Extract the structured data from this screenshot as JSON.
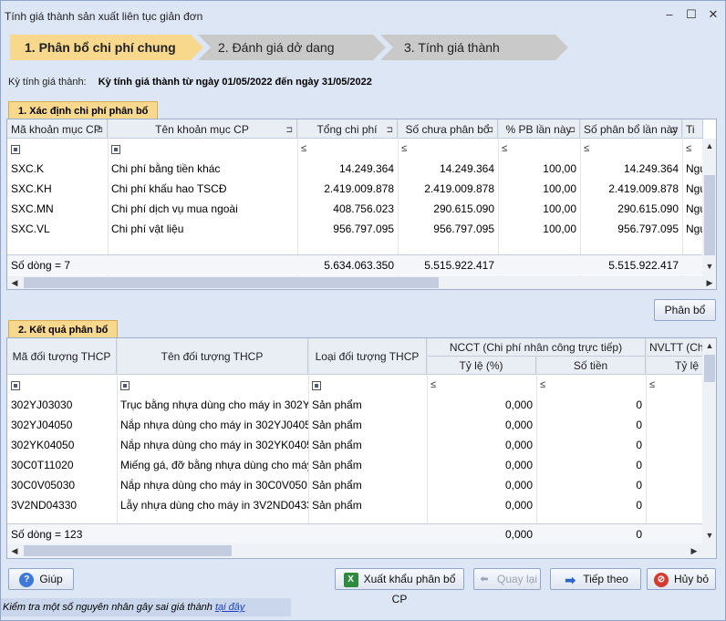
{
  "window": {
    "title": "Tính giá thành sản xuất liên tục giản đơn"
  },
  "steps": [
    "1. Phân bổ chi phí chung",
    "2. Đánh giá dở dang",
    "3. Tính giá thành"
  ],
  "period": {
    "label": "Kỳ tính giá thành:",
    "value": "Kỳ tính giá thành từ ngày 01/05/2022 đến ngày 31/05/2022"
  },
  "section1": {
    "title": "1. Xác định chi phí phân bổ",
    "headers": [
      "Mã khoản mục CP",
      "Tên khoản mục CP",
      "Tổng chi phí",
      "Số chưa phân bổ",
      "% PB lần này",
      "Số phân bổ lần này",
      "Ti"
    ],
    "rows": [
      [
        "SXC.K",
        "Chi phí bằng tiền khác",
        "14.249.364",
        "14.249.364",
        "100,00",
        "14.249.364",
        "Ngu"
      ],
      [
        "SXC.KH",
        "Chi phí khấu hao TSCĐ",
        "2.419.009.878",
        "2.419.009.878",
        "100,00",
        "2.419.009.878",
        "Ngu"
      ],
      [
        "SXC.MN",
        "Chi phí dịch vụ mua ngoài",
        "408.756.023",
        "290.615.090",
        "100,00",
        "290.615.090",
        "Ngu"
      ],
      [
        "SXC.VL",
        "Chi phí vật liệu",
        "956.797.095",
        "956.797.095",
        "100,00",
        "956.797.095",
        "Ngu"
      ]
    ],
    "footer": {
      "count": "Số dòng = 7",
      "total": "5.634.063.350",
      "unallocated": "5.515.922.417",
      "allocated": "5.515.922.417"
    }
  },
  "allocate_button": "Phân bổ",
  "section2": {
    "title": "2. Kết quả phân bổ",
    "headers": {
      "code": "Mã đối tượng THCP",
      "name": "Tên đối tượng THCP",
      "type": "Loại đối tượng THCP",
      "ncct": "NCCT (Chi phí nhân công trực tiếp)",
      "rate": "Tỷ lệ (%)",
      "amount": "Số tiền",
      "nvltt": "NVLTT (Ch",
      "rate2": "Tỷ lệ"
    },
    "rows": [
      [
        "302YJ03030",
        "Trục bằng nhựa dùng cho máy in 302Y...",
        "Sản phẩm",
        "0,000",
        "0"
      ],
      [
        "302YJ04050",
        "Nắp nhựa dùng cho máy in 302YJ04050",
        "Sản phẩm",
        "0,000",
        "0"
      ],
      [
        "302YK04050",
        "Nắp nhựa dùng cho máy in 302YK04050",
        "Sản phẩm",
        "0,000",
        "0"
      ],
      [
        "30C0T11020",
        "Miếng gá, đỡ bằng nhựa dùng cho máy...",
        "Sản phẩm",
        "0,000",
        "0"
      ],
      [
        "30C0V05030",
        "Nắp nhựa dùng cho máy in 30C0V050...",
        "Sản phẩm",
        "0,000",
        "0"
      ],
      [
        "3V2ND04330",
        "Lẫy nhựa dùng cho máy in 3V2ND04330",
        "Sản phẩm",
        "0,000",
        "0"
      ]
    ],
    "footer": {
      "count": "Số dòng = 123",
      "rate": "0,000",
      "amount": "0"
    }
  },
  "buttons": {
    "help": "Giúp",
    "export": "Xuất khẩu phân bổ CP",
    "back": "Quay lại",
    "next": "Tiếp theo",
    "cancel": "Hủy bỏ"
  },
  "status": {
    "text": "Kiểm tra một số nguyên nhân gây sai giá thành ",
    "link": "tại đây"
  }
}
